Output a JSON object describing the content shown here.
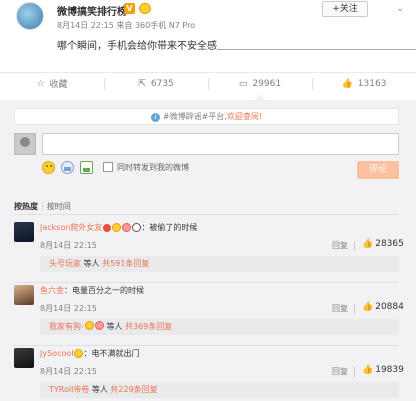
{
  "post": {
    "author": "微博搞笑排行榜",
    "meta": "8月14日 22:15 来自 360手机 N7 Pro",
    "text": "哪个瞬间，手机会给你带来不安全感＿＿＿＿＿＿＿＿＿＿＿＿＿＿＿＿＿＿＿＿＿",
    "follow_label": "+关注",
    "badge": "V"
  },
  "actions": {
    "favorite": "收藏",
    "repost": "6735",
    "comments": "29961",
    "likes": "13163"
  },
  "comment_box": {
    "topic_prefix": "#微博辟谣#平台,",
    "topic_highlight": "欢迎查阅!",
    "placeholder": "",
    "repost_label": "同时转发到我的微博",
    "submit_label": "评论"
  },
  "sort": {
    "hot": "按热度",
    "time": "按时间"
  },
  "comments": [
    {
      "user": "Jackson爬外女友",
      "text": "：被偷了的时候",
      "time": "8月14日 22:15",
      "reply_label": "回复",
      "likes": "28365",
      "sub_user": "头号玩家",
      "sub_mid": "等人",
      "sub_count": "共591条回复"
    },
    {
      "user": "鱼六金",
      "text": "：电量百分之一的时候",
      "time": "8月14日 22:15",
      "reply_label": "回复",
      "likes": "20884",
      "sub_user": "我家有狗-",
      "sub_mid": "等人",
      "sub_count": "共369条回复"
    },
    {
      "user": "JySocool",
      "text": "：电不满就出门",
      "time": "8月14日 22:15",
      "reply_label": "回复",
      "likes": "19839",
      "sub_user": "TYRoll帝卷",
      "sub_mid": "等人",
      "sub_count": "共229条回复"
    }
  ],
  "colors": {
    "accent": "#eb7350",
    "background": "#f2f2f5",
    "submit": "#ffc09f",
    "link_blue": "#6aa3d8"
  },
  "icons": {
    "favorite": "star-outline-icon",
    "repost": "repost-icon",
    "comments": "comment-bubble-icon",
    "likes": "thumbs-up-icon"
  }
}
